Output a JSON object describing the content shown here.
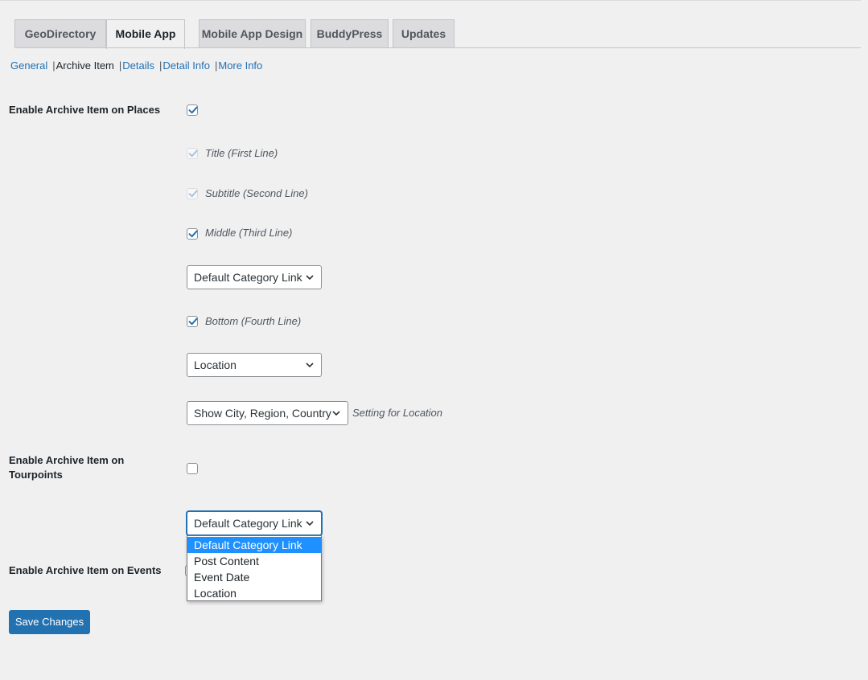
{
  "tabs": [
    {
      "label": "GeoDirectory",
      "active": false
    },
    {
      "label": "Mobile App",
      "active": true
    },
    {
      "label": "Mobile App Design",
      "active": false
    },
    {
      "label": "BuddyPress",
      "active": false
    },
    {
      "label": "Updates",
      "active": false
    }
  ],
  "subnav": {
    "items": [
      "General",
      "Archive Item",
      "Details",
      "Detail Info",
      "More Info"
    ],
    "current": "Archive Item"
  },
  "places": {
    "label": "Enable Archive Item on Places",
    "checked": true,
    "title_label": "Title (First Line)",
    "subtitle_label": "Subtitle (Second Line)",
    "middle_label": "Middle (Third Line)",
    "middle_select": "Default Category Link",
    "bottom_label": "Bottom (Fourth Line)",
    "bottom_select": "Location",
    "location_select": "Show City, Region, Country",
    "location_hint": "Setting for Location"
  },
  "tourpoints": {
    "label": "Enable Archive Item on Tourpoints",
    "checked": false,
    "select_value": "Default Category Link",
    "dropdown_options": [
      "Default Category Link",
      "Post Content",
      "Event Date",
      "Location"
    ],
    "dropdown_selected": "Default Category Link"
  },
  "events": {
    "label": "Enable Archive Item on Events"
  },
  "save_label": "Save Changes",
  "colors": {
    "accent": "#2271b1",
    "highlight": "#1e90ff",
    "background": "#f0f0f1"
  }
}
